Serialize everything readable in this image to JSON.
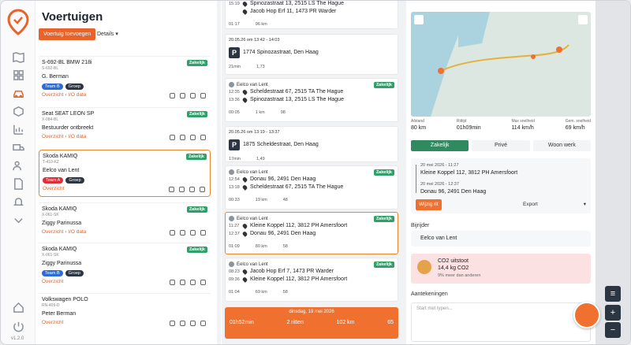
{
  "app": {
    "title": "Voertuigen",
    "add_label": "Voertuig toevoegen",
    "details_label": "Details",
    "version": "v1.2.0",
    "accent": "#e8622a"
  },
  "vehicles": [
    {
      "name": "S-692-BL BMW 218i",
      "plate": "S-692-BL",
      "tag": "Zakelijk",
      "driver": "G. Berman",
      "badges": [
        "Team B",
        "Groep"
      ],
      "link": "Overzicht › I/O data"
    },
    {
      "name": "Seat SEAT LEON SP",
      "plate": "X-084-BL",
      "tag": "Zakelijk",
      "driver": "Bestuurder ontbreekt",
      "badges": [],
      "link": "Overzicht › I/O data"
    },
    {
      "name": "Skoda KAMIQ",
      "plate": "T-410-KZ",
      "tag": "Zakelijk",
      "driver": "Eelco van Lent",
      "badges": [
        "Team A",
        "Groep"
      ],
      "link": "Overzicht"
    },
    {
      "name": "Skoda KAMIQ",
      "plate": "X-061-SK",
      "tag": "Zakelijk",
      "driver": "Ziggy Parinussa",
      "badges": [],
      "link": "Overzicht › I/O data"
    },
    {
      "name": "Skoda KAMIQ",
      "plate": "X-061-SK",
      "tag": "Zakelijk",
      "driver": "Ziggy Parinussa",
      "badges": [
        "Team B",
        "Groep"
      ],
      "link": "Overzicht"
    },
    {
      "name": "Volkswagen POLO",
      "plate": "RN-409-D",
      "tag": "",
      "driver": "Peter Berman",
      "badges": [],
      "link": "Overzicht"
    }
  ],
  "trips": [
    {
      "t1": "15:19",
      "a1": "Spinozastraat 13, 2515 LS The Hague",
      "t2": "",
      "a2": "Jacob Hop Erf 11, 1473 PR Warder",
      "dur": "01:17",
      "km": "96 km",
      "score": ""
    },
    {
      "head": "20.05.26 om 13:42 - 14:03",
      "addr": "1774 Spinozastraat, Den Haag",
      "dur": "21min",
      "x": "1,73"
    },
    {
      "head": "Eelco van Lent",
      "tag": "Zakelijk",
      "t1": "12:35",
      "a1": "Scheldestraat 67, 2515 TA The Hague",
      "t2": "13:36",
      "a2": "Spinozastraat 13, 2515 LS The Hague",
      "dur": "00:05",
      "km": "1 km",
      "score": "98"
    },
    {
      "head": "20.05.26 om 13:19 - 13:37",
      "addr": "1875 Scheldestraat, Den Haag",
      "dur": "17min",
      "x": "1,49"
    },
    {
      "head": "Eelco van Lent",
      "tag": "Zakelijk",
      "t1": "12:54",
      "a1": "Donau 96, 2491 Den Haag",
      "t2": "13:18",
      "a2": "Scheldestraat 67, 2515 TA The Hague",
      "dur": "00:33",
      "km": "19 km",
      "score": "48"
    },
    {
      "head": "Eelco van Lent",
      "tag": "Zakelijk",
      "t1": "11:27",
      "a1": "Kleine Koppel 112, 3812 PH Amersfoort",
      "t2": "12:37",
      "a2": "Donau 96, 2491 Den Haag",
      "dur": "01:09",
      "km": "80 km",
      "score": "58"
    },
    {
      "head": "Eelco van Lent",
      "tag": "Zakelijk",
      "t1": "08:23",
      "a1": "Jacob Hop Erf 7, 1473 PR Warder",
      "t2": "09:36",
      "a2": "Kleine Koppel 112, 3812 PH Amersfoort",
      "dur": "01:04",
      "km": "69 km",
      "score": "58"
    }
  ],
  "day": {
    "title": "dinsdag, 19 mei 2026",
    "dur": "01h52min",
    "trips": "2 ritten",
    "km": "102 km",
    "score": "65"
  },
  "detail": {
    "stats": [
      {
        "l": "Afstand",
        "v": "80 km"
      },
      {
        "l": "Rittijd",
        "v": "01h09min"
      },
      {
        "l": "Max snelheid",
        "v": "114 km/h"
      },
      {
        "l": "Gem. snelheid",
        "v": "69 km/h"
      }
    ],
    "seg": [
      "Zakelijk",
      "Privé",
      "Woon werk"
    ],
    "route": {
      "d1": "20 mei 2026 - 11:27",
      "a1": "Kleine Koppel 112, 3812 PH Amersfoort",
      "d2": "20 mei 2026 - 12:37",
      "a2": "Donau 96, 2491 Den Haag"
    },
    "fix": "Wijzig rit",
    "export": "Export",
    "driver_label": "Bijrijder",
    "driver": "Eelco van Lent",
    "co2_title": "CO2 uitstoot",
    "co2_val": "14,4 kg CO2",
    "co2_cmp": "9% meer dan anderen",
    "notes_label": "Aantekeningen",
    "notes_ph": "Start met typen..."
  }
}
